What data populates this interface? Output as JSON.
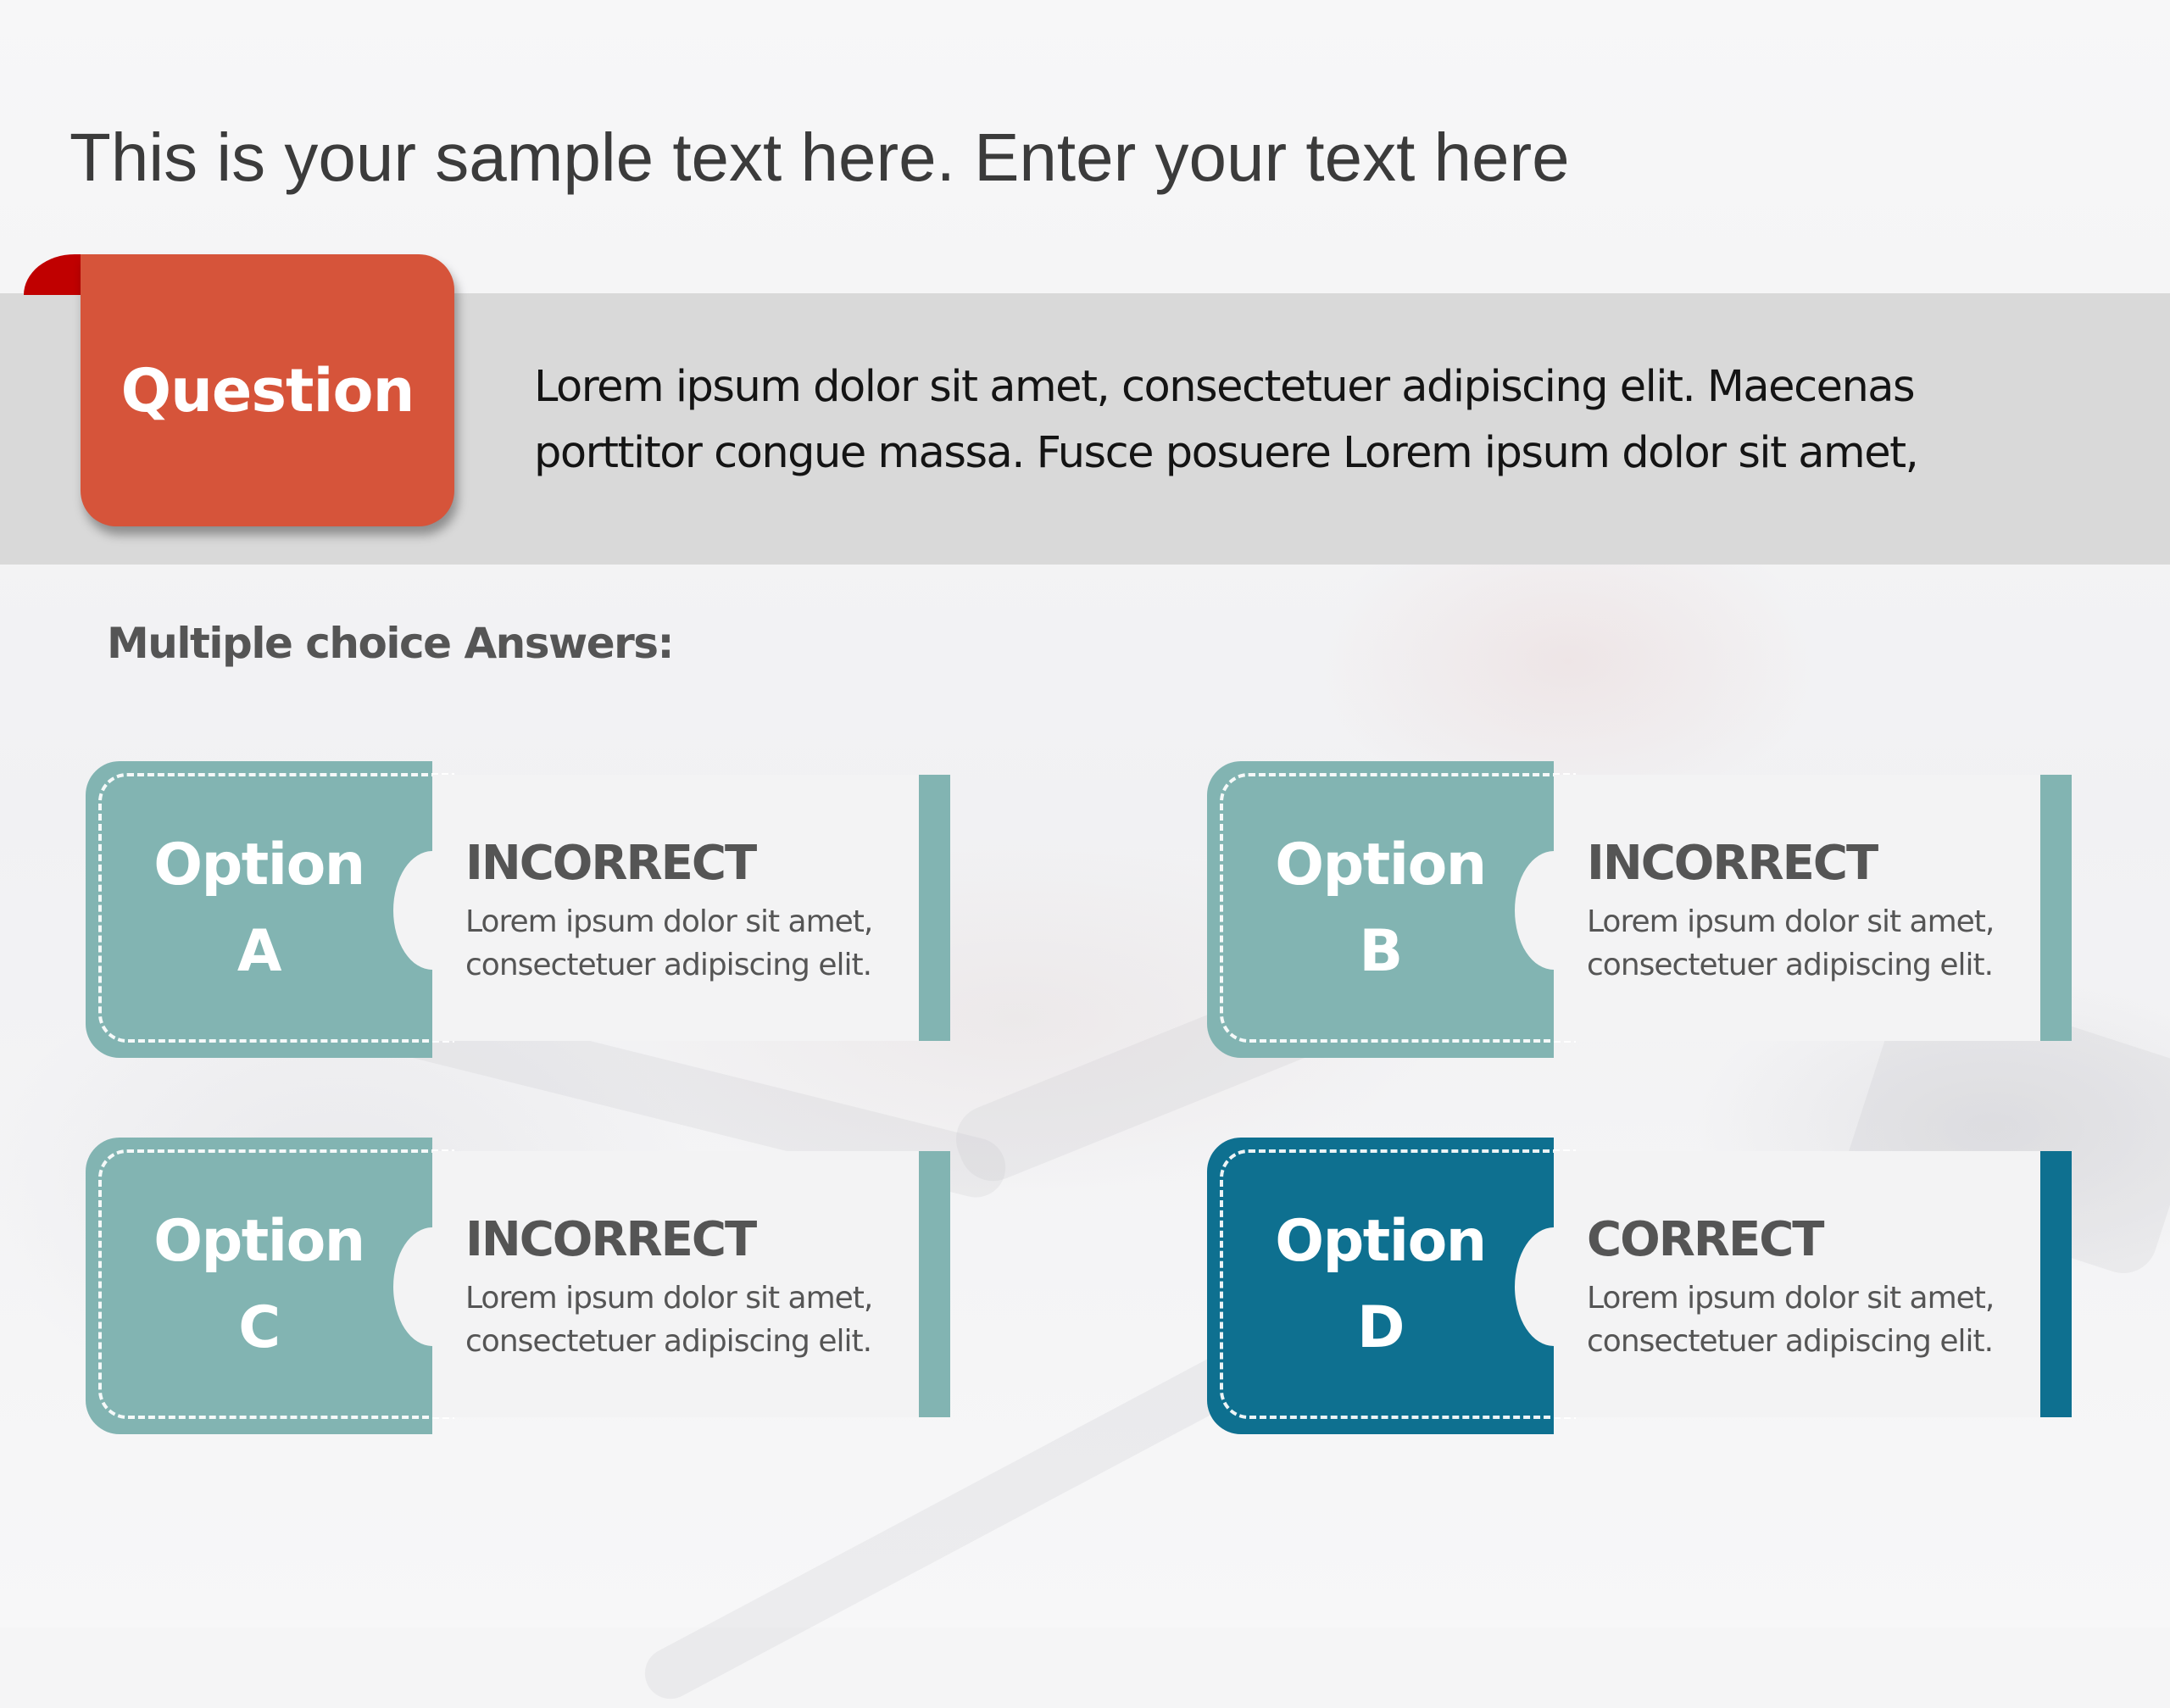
{
  "slide": {
    "title": "This is your sample text here. Enter your text here"
  },
  "question": {
    "label": "Question",
    "text_lines": [
      "Lorem ipsum dolor sit amet, consectetuer adipiscing elit. Maecenas",
      "porttitor congue massa. Fusce posuere Lorem ipsum dolor sit amet,"
    ],
    "colors": {
      "tab": "#d6543a",
      "curl": "#c00000",
      "band": "#d9d9d9"
    }
  },
  "answers": {
    "heading": "Multiple choice Answers:",
    "options": [
      {
        "word": "Option",
        "letter": "A",
        "status": "INCORRECT",
        "desc_lines": [
          "Lorem ipsum dolor sit amet,",
          "consectetuer adipiscing elit."
        ],
        "color": "#82b4b2"
      },
      {
        "word": "Option",
        "letter": "B",
        "status": "INCORRECT",
        "desc_lines": [
          "Lorem ipsum dolor sit amet,",
          "consectetuer adipiscing elit."
        ],
        "color": "#82b4b2"
      },
      {
        "word": "Option",
        "letter": "C",
        "status": "INCORRECT",
        "desc_lines": [
          "Lorem ipsum dolor sit amet,",
          "consectetuer adipiscing elit."
        ],
        "color": "#82b4b2"
      },
      {
        "word": "Option",
        "letter": "D",
        "status": "CORRECT",
        "desc_lines": [
          "Lorem ipsum dolor sit amet,",
          "consectetuer adipiscing elit."
        ],
        "color": "#0e7090"
      }
    ]
  }
}
